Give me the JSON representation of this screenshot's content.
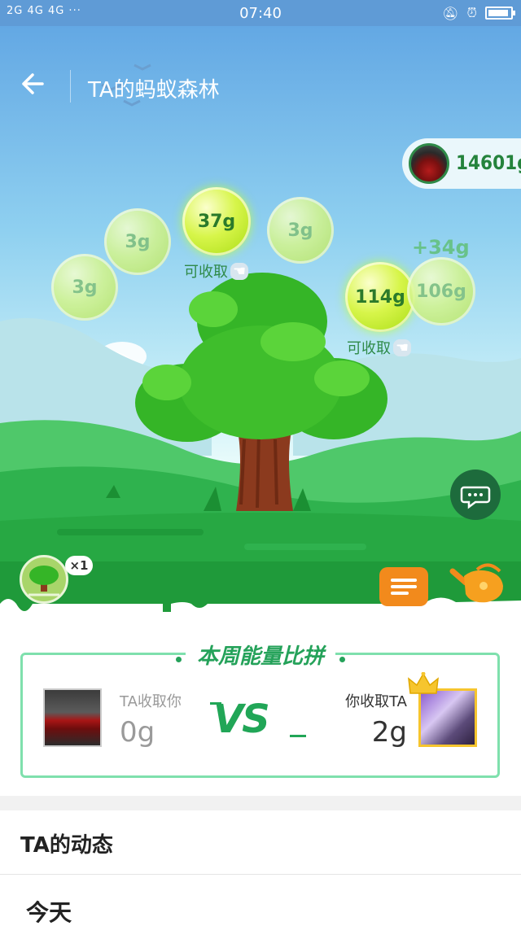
{
  "status_bar": {
    "signal": "2G 4G 4G ···",
    "time": "07:40"
  },
  "header": {
    "back_icon": "arrow-left-icon",
    "title": "TA的蚂蚁森林"
  },
  "my_energy": {
    "value": "14601g"
  },
  "energy_bubbles": [
    {
      "label": "3g",
      "ready": false
    },
    {
      "label": "3g",
      "ready": false
    },
    {
      "label": "37g",
      "ready": true
    },
    {
      "label": "3g",
      "ready": false
    },
    {
      "label": "114g",
      "ready": true
    },
    {
      "label": "106g",
      "ready": false
    }
  ],
  "collect_hint": "可收取",
  "plus_energy": "+34g",
  "tree_count": "×1",
  "comparison": {
    "title": "本周能量比拼",
    "ta_took_label": "TA收取你",
    "ta_took_value": "0g",
    "vs": "VS",
    "you_took_label": "你收取TA",
    "you_took_value": "2g"
  },
  "dynamics": {
    "title": "TA的动态",
    "today": "今天"
  },
  "colors": {
    "accent_green": "#25a25a",
    "sky_top": "#63a8e4",
    "orange": "#f28a1c"
  }
}
